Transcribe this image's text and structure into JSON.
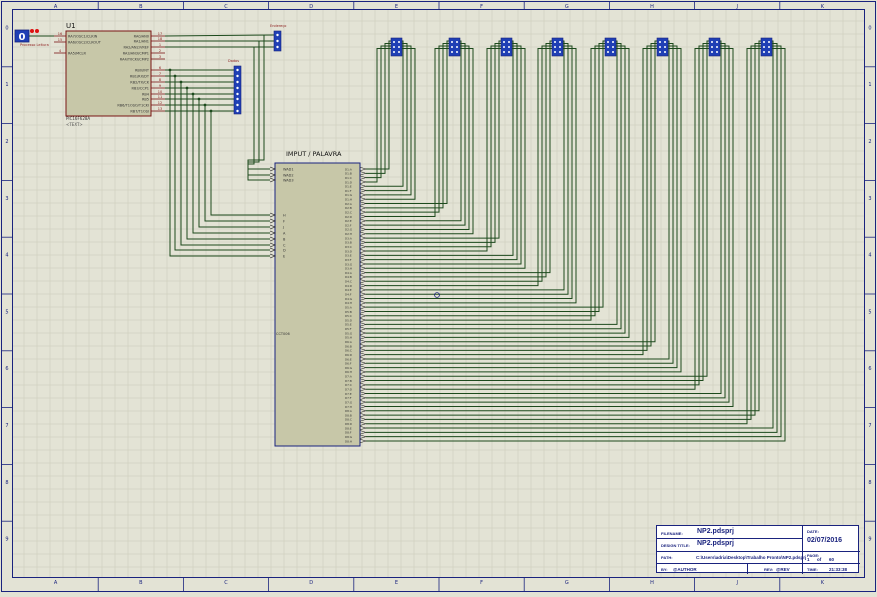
{
  "colors": {
    "background": "#e3e3d5",
    "grid": "#c9c9b8",
    "border": "#1a237e",
    "wire": "#1c4a1c",
    "chip_fill": "#c7c7a8",
    "chip_border": "#7a1515",
    "label_red": "#8b1a1a",
    "pin_blue": "#1a237e",
    "probe_fill": "#1f3fb5"
  },
  "frame": {
    "columns": [
      "A",
      "B",
      "C",
      "D",
      "E",
      "F",
      "G",
      "H",
      "J",
      "K"
    ],
    "rows": [
      "0",
      "1",
      "2",
      "3",
      "4",
      "5",
      "6",
      "7",
      "8",
      "9"
    ]
  },
  "probe": {
    "value": "0",
    "label": "Processo Leitura"
  },
  "u1": {
    "ref": "U1",
    "part": "PIC16F628A",
    "text_hint": "<TEXT>",
    "left_pins": [
      {
        "num": "16",
        "name": "RA7/OSC1/CLKIN"
      },
      {
        "num": "15",
        "name": "RA6/OSC2/CLKOUT"
      },
      {
        "num": "4",
        "name": "RA5/MCLR"
      }
    ],
    "right_pins": [
      {
        "num": "17",
        "name": "RA0/AN0"
      },
      {
        "num": "18",
        "name": "RA1/AN1"
      },
      {
        "num": "1",
        "name": "RA2/AN2/VREF"
      },
      {
        "num": "2",
        "name": "RA3/AN3/CMP1"
      },
      {
        "num": "3",
        "name": "RA4/T0CKI/CMP2"
      },
      {
        "num": "6",
        "name": "RB0/INT"
      },
      {
        "num": "7",
        "name": "RB1/RX/DT"
      },
      {
        "num": "8",
        "name": "RB2/TX/CK"
      },
      {
        "num": "9",
        "name": "RB3/CCP1"
      },
      {
        "num": "10",
        "name": "RB4"
      },
      {
        "num": "11",
        "name": "RB5"
      },
      {
        "num": "12",
        "name": "RB6/T1OSO/T1CKI"
      },
      {
        "num": "13",
        "name": "RB7/T1OSI"
      }
    ]
  },
  "connectors": {
    "addr_label": "Endereço",
    "data_label": "Dados"
  },
  "imput": {
    "title": "IMPUT / PALAVRA",
    "part": "CCT006",
    "addr_pins": [
      "WAD1",
      "WAD2",
      "WAD3"
    ],
    "data_pins": [
      "H",
      "F",
      "J",
      "A",
      "B",
      "C",
      "D",
      "E"
    ],
    "outputs": [
      "D1:A",
      "D1:B",
      "D1:C",
      "D1:D",
      "D1:E",
      "D1:F",
      "D1:G",
      "D1:H",
      "D2:A",
      "D2:B",
      "D2:C",
      "D2:D",
      "D2:E",
      "D2:F",
      "D2:G",
      "D2:H",
      "D3:A",
      "D3:B",
      "D3:C",
      "D3:D",
      "D3:E",
      "D3:F",
      "D3:G",
      "D3:H",
      "D4:A",
      "D4:B",
      "D4:C",
      "D4:D",
      "D4:E",
      "D4:F",
      "D4:G",
      "D4:H",
      "D5:A",
      "D5:B",
      "D5:C",
      "D5:D",
      "D5:E",
      "D5:F",
      "D5:G",
      "D5:H",
      "D6:A",
      "D6:B",
      "D6:C",
      "D6:D",
      "D6:E",
      "D6:F",
      "D6:G",
      "D6:H",
      "D7:A",
      "D7:B",
      "D7:C",
      "D7:D",
      "D7:E",
      "D7:F",
      "D7:G",
      "D7:H",
      "D8:A",
      "D8:B",
      "D8:C",
      "D8:D",
      "D8:E",
      "D8:F",
      "D8:G",
      "D8:H"
    ]
  },
  "displays": [
    "D1",
    "D2",
    "D3",
    "D4",
    "D5",
    "D6",
    "D7",
    "D8"
  ],
  "title_block": {
    "filename_label": "FILENAME:",
    "filename": "NP2.pdsprj",
    "design_title_label": "DESIGN TITLE:",
    "design_title": "NP2.pdsprj",
    "path_label": "PATH:",
    "path": "C:\\Users\\adria\\Desktop\\Trabalho Pronto\\NP2.pdsprj",
    "by_label": "BY:",
    "by": "@AUTHOR",
    "rev_label": "REV:",
    "rev": "@REV",
    "date_label": "DATE:",
    "date": "02/07/2016",
    "page_label": "PAGE:",
    "page": "1",
    "of_label": "of",
    "pages": "60",
    "time_label": "TIME:",
    "time": "21:33:38"
  }
}
